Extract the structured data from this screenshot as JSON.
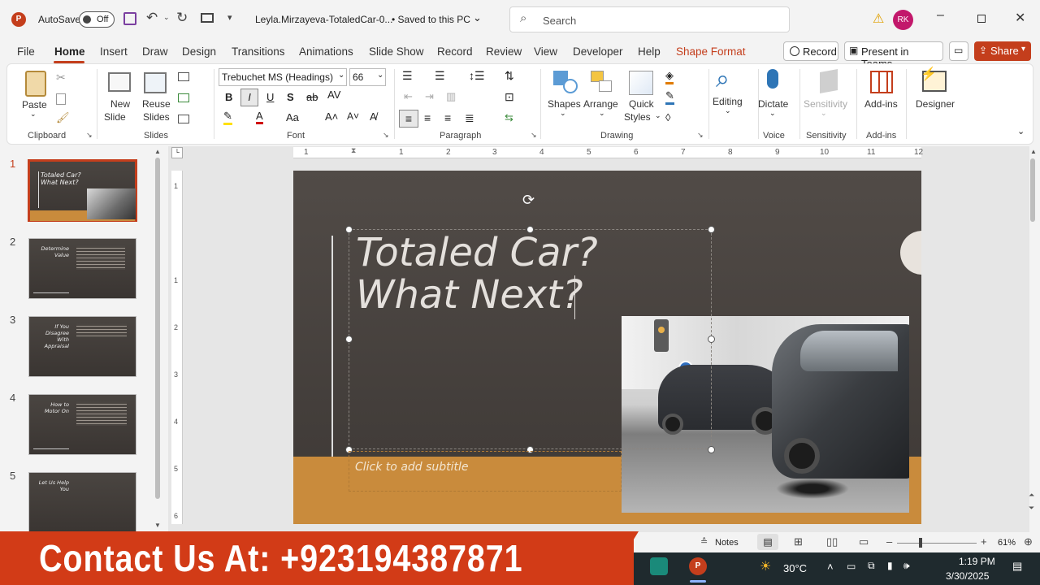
{
  "titlebar": {
    "autosave_label": "AutoSave",
    "autosave_state": "Off",
    "doc_title": "Leyla.Mirzayeva-TotaledCar-0...",
    "save_status": "• Saved to this PC",
    "search_placeholder": "Search",
    "user_initials": "RK"
  },
  "tabs": [
    "File",
    "Home",
    "Insert",
    "Draw",
    "Design",
    "Transitions",
    "Animations",
    "Slide Show",
    "Record",
    "Review",
    "View",
    "Developer",
    "Help",
    "Shape Format"
  ],
  "tab_actions": {
    "record": "Record",
    "present": "Present in Teams",
    "share": "Share"
  },
  "ribbon": {
    "clipboard": {
      "paste": "Paste",
      "group": "Clipboard"
    },
    "slides": {
      "new_slide": "New",
      "new_slide2": "Slide",
      "reuse": "Reuse",
      "reuse2": "Slides",
      "group": "Slides"
    },
    "font": {
      "name": "Trebuchet MS (Headings)",
      "size": "66",
      "group": "Font"
    },
    "paragraph": {
      "group": "Paragraph"
    },
    "drawing": {
      "shapes": "Shapes",
      "arrange": "Arrange",
      "quick": "Quick",
      "styles": "Styles",
      "group": "Drawing"
    },
    "editing": {
      "label": "Editing"
    },
    "voice": {
      "dictate": "Dictate",
      "group": "Voice"
    },
    "sensitivity": {
      "label": "Sensitivity",
      "group": "Sensitivity"
    },
    "addins": {
      "label": "Add-ins",
      "group": "Add-ins"
    },
    "designer": {
      "label": "Designer"
    }
  },
  "ruler_h": [
    "1",
    "1",
    "2",
    "3",
    "4",
    "5",
    "6",
    "7",
    "8",
    "9",
    "10",
    "11",
    "12"
  ],
  "ruler_v": [
    "1",
    "1",
    "2",
    "3",
    "4",
    "5",
    "6"
  ],
  "thumbnails": [
    {
      "num": "1",
      "title": "Totaled Car?\nWhat Next?"
    },
    {
      "num": "2",
      "title": "Determine\nValue"
    },
    {
      "num": "3",
      "title": "If You\nDisagree\nWith\nAppraisal"
    },
    {
      "num": "4",
      "title": "How to\nMotor On"
    },
    {
      "num": "5",
      "title": "Let Us Help\nYou"
    }
  ],
  "slide": {
    "title_line1": "Totaled Car?",
    "title_line2": "What Next?",
    "subtitle_placeholder": "Click to add subtitle"
  },
  "status": {
    "notes": "Notes",
    "zoom": "61%"
  },
  "banner": {
    "text": "Contact Us At: +923194387871"
  },
  "taskbar": {
    "temp": "30°C",
    "time": "1:19 PM",
    "date": "3/30/2025"
  }
}
